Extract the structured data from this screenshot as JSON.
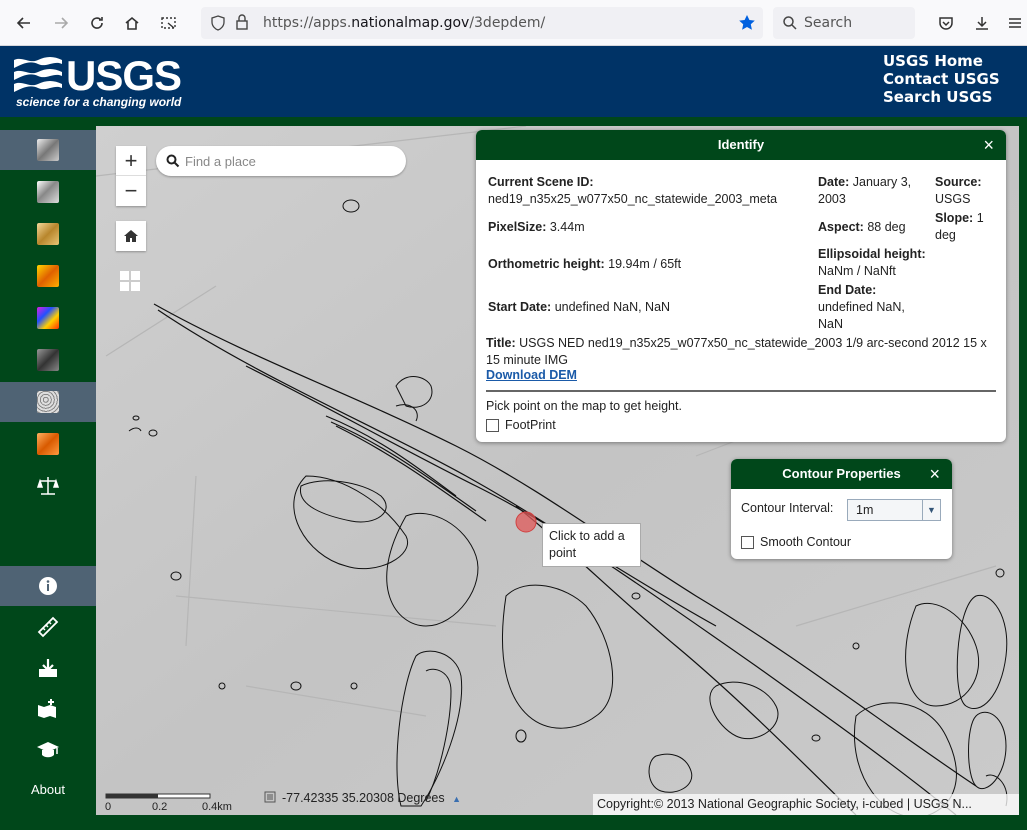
{
  "browser": {
    "url_prefix": "https://apps.",
    "url_domain": "nationalmap.gov",
    "url_path": "/3depdem/",
    "search_placeholder": "Search"
  },
  "header": {
    "logo_text": "USGS",
    "logo_tagline": "science for a changing world",
    "links": [
      "USGS Home",
      "Contact USGS",
      "Search USGS"
    ]
  },
  "sidebar": {
    "about_label": "About",
    "layer_icons": [
      "hillshade-icon",
      "multidirectional-hillshade-icon",
      "tinted-hillshade-icon",
      "elevation-tinted-icon",
      "aspect-icon",
      "slope-icon",
      "contour-icon",
      "slope-tinted-icon",
      "balance-icon"
    ],
    "tool_icons": [
      "info-icon",
      "ruler-icon",
      "download-icon",
      "add-map-icon",
      "education-icon"
    ]
  },
  "map": {
    "search_placeholder": "Find a place",
    "zoom_in": "+",
    "zoom_out": "−",
    "coords": "-77.42335 35.20308 Degrees",
    "copyright": "Copyright:© 2013 National Geographic Society, i-cubed | USGS N...",
    "scale_labels": [
      "0",
      "0.2",
      "0.4km"
    ],
    "tooltip": "Click to add a point"
  },
  "identify": {
    "title": "Identify",
    "close": "×",
    "scene_label": "Current Scene ID:",
    "scene_value": "ned19_n35x25_w077x50_nc_statewide_2003_meta",
    "pixel_label": "PixelSize:",
    "pixel_value": "3.44m",
    "ortho_label": "Orthometric height:",
    "ortho_value": "19.94m / 65ft",
    "start_label": "Start Date:",
    "start_value": "undefined NaN, NaN",
    "date_label": "Date:",
    "date_value": "January 3, 2003",
    "source_label": "Source:",
    "source_value": "USGS",
    "aspect_label": "Aspect:",
    "aspect_value": "88 deg",
    "slope_label": "Slope:",
    "slope_value": "1 deg",
    "ellip_label": "Ellipsoidal height:",
    "ellip_value": "NaNm / NaNft",
    "end_label": "End Date:",
    "end_value": "undefined NaN, NaN",
    "title_label": "Title:",
    "title_value": "USGS NED ned19_n35x25_w077x50_nc_statewide_2003 1/9 arc-second 2012 15 x 15 minute IMG",
    "download": "Download DEM",
    "pick_text": "Pick point on the map to get height.",
    "footprint": "FootPrint"
  },
  "contour": {
    "title": "Contour Properties",
    "close": "×",
    "interval_label": "Contour Interval:",
    "interval_value": "1m",
    "smooth": "Smooth Contour"
  }
}
